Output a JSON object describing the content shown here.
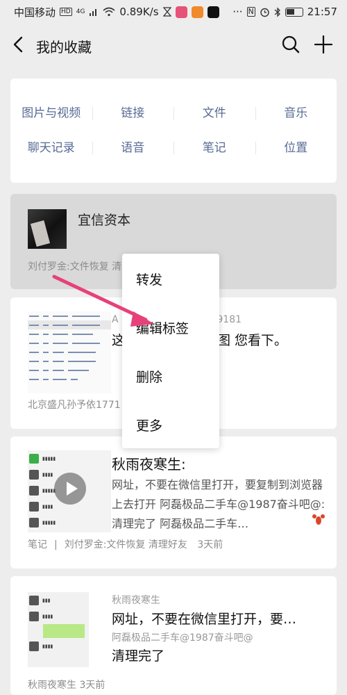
{
  "status_bar": {
    "carrier": "中国移动",
    "hd_badge": "HD",
    "network": "4G",
    "speed": "0.89K/s",
    "time": "21:57",
    "icons": [
      "signal-icon",
      "wifi-icon",
      "hourglass-icon",
      "app-icon",
      "nfc-icon",
      "alarm-icon",
      "bluetooth-icon",
      "battery-icon"
    ]
  },
  "header": {
    "title": "我的收藏",
    "back_icon": "back-arrow-icon",
    "search_icon": "search-icon",
    "add_icon": "plus-icon"
  },
  "categories": {
    "row1": [
      "图片与视频",
      "链接",
      "文件",
      "音乐"
    ],
    "row2": [
      "聊天记录",
      "语音",
      "笔记",
      "位置"
    ],
    "color": "#576b95"
  },
  "items": [
    {
      "title": "宜信资本",
      "footer": "刘付罗金:文件恢复 清"
    },
    {
      "meta": "A",
      "meta_suffix": "169181",
      "main_prefix": "这",
      "main_suffix": "截图 您看下。",
      "footer": "北京盛凡孙予依1771"
    },
    {
      "title": "秋雨夜寒生:",
      "body": "网址，不要在微信里打开，要复制到浏览器上去打开  阿磊极品二手车@1987奋斗吧@: 清理完了  阿磊极品二手车…",
      "footer_type": "笔记",
      "footer_source": "刘付罗金:文件恢复 清理好友",
      "footer_time": "3天前"
    },
    {
      "sender": "秋雨夜寒生",
      "line1": "网址，不要在微信里打开，要…",
      "line2": "阿磊极品二手车@1987奋斗吧@",
      "line3": "清理完了",
      "footer": "秋雨夜寒生   3天前"
    }
  ],
  "context_menu": {
    "items": [
      "转发",
      "编辑标签",
      "删除",
      "更多"
    ]
  },
  "annotation": {
    "arrow_color": "#e8407a"
  }
}
